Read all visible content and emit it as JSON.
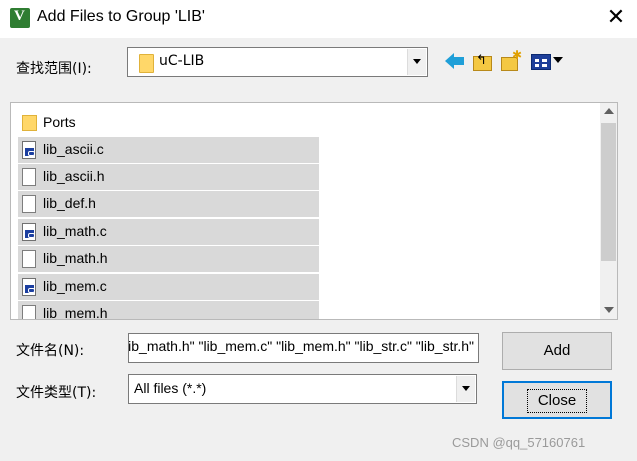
{
  "window": {
    "title": "Add Files to Group 'LIB'",
    "close_glyph": "✕"
  },
  "lookin": {
    "label": "查找范围(I):",
    "value": "uC-LIB"
  },
  "toolbar": {
    "icons": [
      "back-icon",
      "up-folder-icon",
      "new-folder-icon",
      "view-menu-icon"
    ]
  },
  "files": [
    {
      "name": "Ports",
      "type": "folder",
      "selected": false
    },
    {
      "name": "lib_ascii.c",
      "type": "c",
      "selected": true
    },
    {
      "name": "lib_ascii.h",
      "type": "h",
      "selected": true
    },
    {
      "name": "lib_def.h",
      "type": "h",
      "selected": true
    },
    {
      "name": "lib_math.c",
      "type": "c",
      "selected": true
    },
    {
      "name": "lib_math.h",
      "type": "h",
      "selected": true
    },
    {
      "name": "lib_mem.c",
      "type": "c",
      "selected": true
    },
    {
      "name": "lib_mem.h",
      "type": "h",
      "selected": true
    }
  ],
  "filename": {
    "label": "文件名(N):",
    "value": "‎\"lib_ascii.c\" \"lib_ascii.h\" \"lib_def.h\" \"lib_math.c\" \"lib_math.h\" \"lib_mem.c\" \"lib_mem.h\" \"lib_str.c\" \"lib_str.h\"‎"
  },
  "filetype": {
    "label": "文件类型(T):",
    "value": "All files (*.*)"
  },
  "buttons": {
    "add": "Add",
    "close": "Close"
  },
  "watermark": "CSDN @qq_57160761",
  "colors": {
    "selection": "#d9d9d9",
    "focus_border": "#0078d7",
    "folder": "#ffd769"
  }
}
